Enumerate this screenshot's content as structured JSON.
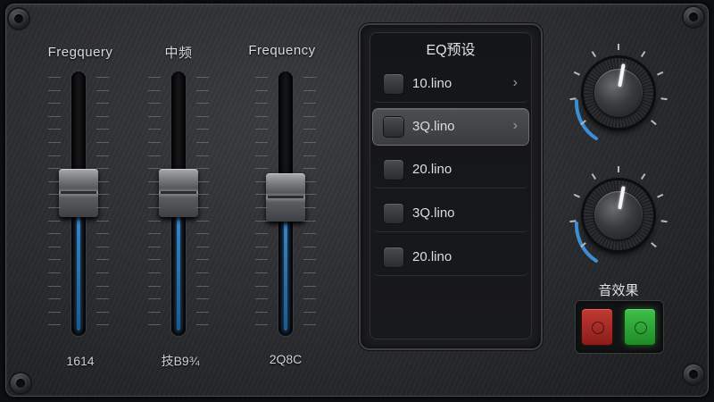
{
  "faders": [
    {
      "label": "Fregquery",
      "value_text": "1614",
      "level": 0.6
    },
    {
      "label": "中频",
      "value_text": "技B9¾",
      "level": 0.6
    },
    {
      "label": "Frequency",
      "value_text": "2Q8C",
      "level": 0.58
    }
  ],
  "eq_presets": {
    "title": "EQ预设",
    "items": [
      {
        "label": "10.lino",
        "selected": false,
        "chevron": "›"
      },
      {
        "label": "3Q.lino",
        "selected": true,
        "chevron": "›"
      },
      {
        "label": "20.lino",
        "selected": false,
        "chevron": ""
      },
      {
        "label": "3Q.lino",
        "selected": false,
        "chevron": ""
      },
      {
        "label": "20.lino",
        "selected": false,
        "chevron": ""
      }
    ]
  },
  "knobs": [
    {
      "name": "knob-1",
      "angle_deg": 10,
      "arc_color": "#3a8fd6"
    },
    {
      "name": "knob-2",
      "angle_deg": 10,
      "arc_color": "#3a8fd6"
    }
  ],
  "sound_effects": {
    "label": "音效果",
    "buttons": [
      {
        "name": "off",
        "color": "#c23a35"
      },
      {
        "name": "on",
        "color": "#3fc049"
      }
    ]
  }
}
